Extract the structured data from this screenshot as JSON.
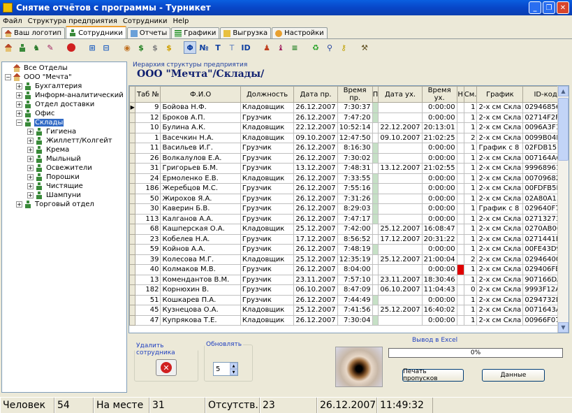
{
  "window": {
    "title": "Снятие отчётов с программы - Турникет"
  },
  "menu": [
    "Файл",
    "Структура предприятия",
    "Сотрудники",
    "Help"
  ],
  "tabs": [
    {
      "label": "Ваш логотип",
      "icon": "home-icon"
    },
    {
      "label": "Сотрудники",
      "icon": "person-icon",
      "active": true
    },
    {
      "label": "Отчеты",
      "icon": "report-icon"
    },
    {
      "label": "Графики",
      "icon": "schedule-icon"
    },
    {
      "label": "Выгрузка",
      "icon": "export-icon"
    },
    {
      "label": "Настройки",
      "icon": "settings-icon"
    }
  ],
  "tree": [
    {
      "label": "Все Отделы",
      "level": 0,
      "pm": "none"
    },
    {
      "label": "ООО \"Мечта\"",
      "level": 0,
      "pm": "−"
    },
    {
      "label": "Бухгалтерия",
      "level": 1,
      "pm": "+"
    },
    {
      "label": "Информ-аналитический",
      "level": 1,
      "pm": "+"
    },
    {
      "label": "Отдел доставки",
      "level": 1,
      "pm": "+"
    },
    {
      "label": "Офис",
      "level": 1,
      "pm": "+"
    },
    {
      "label": "Склады",
      "level": 1,
      "pm": "−",
      "selected": true
    },
    {
      "label": "Гигиена",
      "level": 2,
      "pm": "+"
    },
    {
      "label": "Жиллетт/Колгейт",
      "level": 2,
      "pm": "+"
    },
    {
      "label": "Крема",
      "level": 2,
      "pm": "+"
    },
    {
      "label": "Мыльный",
      "level": 2,
      "pm": "+"
    },
    {
      "label": "Освежители",
      "level": 2,
      "pm": "+"
    },
    {
      "label": "Порошки",
      "level": 2,
      "pm": "+"
    },
    {
      "label": "Чистящие",
      "level": 2,
      "pm": "+"
    },
    {
      "label": "Шампуни",
      "level": 2,
      "pm": "+"
    },
    {
      "label": "Торговый отдел",
      "level": 1,
      "pm": "+"
    }
  ],
  "hierarchy_caption": "Иерархия структуры предприятия",
  "breadcrumb": "ООО \"Мечта\"/Склады/",
  "columns": [
    "Таб №",
    "Ф.И.О",
    "Должность",
    "Дата пр.",
    "Время пр.",
    "П",
    "Дата ух.",
    "Время ух.",
    "Н",
    "См.",
    "График",
    "ID-код"
  ],
  "rows": [
    [
      "9",
      "Бойова Н.Ф.",
      "Кладовщик",
      "26.12.2007",
      "7:30:37",
      "g",
      "",
      "0:00:00",
      "",
      "1",
      "2-х см Скла",
      "02946856"
    ],
    [
      "12",
      "Броков А.П.",
      "Грузчик",
      "26.12.2007",
      "7:47:20",
      "g",
      "",
      "0:00:00",
      "",
      "1",
      "2-х см Скла",
      "02714F2F"
    ],
    [
      "10",
      "Булина А.К.",
      "Кладовщик",
      "22.12.2007",
      "10:52:14",
      "",
      "22.12.2007",
      "20:13:01",
      "",
      "1",
      "2-х см Скла",
      "0096A3F1"
    ],
    [
      "1",
      "Васечкин Н.А.",
      "Кладовщик",
      "09.10.2007",
      "12:47:50",
      "",
      "09.10.2007",
      "21:02:25",
      "",
      "2",
      "2-х см Скла",
      "0099B04D"
    ],
    [
      "11",
      "Васильев И.Г.",
      "Грузчик",
      "26.12.2007",
      "8:16:30",
      "g",
      "",
      "0:00:00",
      "",
      "1",
      "График с 8",
      "02FDB15B"
    ],
    [
      "26",
      "Волкалулов Е.А.",
      "Грузчик",
      "26.12.2007",
      "7:30:02",
      "g",
      "",
      "0:00:00",
      "",
      "1",
      "2-х см Скла",
      "007164A6"
    ],
    [
      "31",
      "Григорьев Б.М.",
      "Грузчик",
      "13.12.2007",
      "7:48:31",
      "",
      "13.12.2007",
      "21:02:55",
      "",
      "1",
      "2-х см Скла",
      "99968961"
    ],
    [
      "24",
      "Ермоленко Е.В.",
      "Кладовщик",
      "26.12.2007",
      "7:33:55",
      "g",
      "",
      "0:00:00",
      "",
      "1",
      "2-х см Скла",
      "00709682"
    ],
    [
      "186",
      "Жеребцов М.С.",
      "Грузчик",
      "26.12.2007",
      "7:55:16",
      "g",
      "",
      "0:00:00",
      "",
      "1",
      "2-х см Скла",
      "00FDFB5E"
    ],
    [
      "50",
      "Жирохов Я.А.",
      "Грузчик",
      "26.12.2007",
      "7:31:26",
      "g",
      "",
      "0:00:00",
      "",
      "1",
      "2-х см Скла",
      "02A80A13"
    ],
    [
      "30",
      "Каверин Б.В.",
      "Грузчик",
      "26.12.2007",
      "8:29:03",
      "g",
      "",
      "0:00:00",
      "",
      "1",
      "График с 8",
      "029640F7"
    ],
    [
      "113",
      "Калганов А.А.",
      "Грузчик",
      "26.12.2007",
      "7:47:17",
      "g",
      "",
      "0:00:00",
      "",
      "1",
      "2-х см Скла",
      "02713273"
    ],
    [
      "68",
      "Кашперская О.А.",
      "Кладовщик",
      "25.12.2007",
      "7:42:00",
      "",
      "25.12.2007",
      "16:08:47",
      "",
      "1",
      "2-х см Скла",
      "0270AB00"
    ],
    [
      "23",
      "Кобелев Н.А.",
      "Грузчик",
      "17.12.2007",
      "8:56:52",
      "",
      "17.12.2007",
      "20:31:22",
      "",
      "1",
      "2-х см Скла",
      "0271441B"
    ],
    [
      "59",
      "Койнов А.А.",
      "Грузчик",
      "26.12.2007",
      "7:48:19",
      "g",
      "",
      "0:00:00",
      "",
      "1",
      "2-х см Скла",
      "00FE43D9"
    ],
    [
      "39",
      "Колесова М.Г.",
      "Кладовщик",
      "25.12.2007",
      "12:35:19",
      "",
      "25.12.2007",
      "21:00:04",
      "",
      "2",
      "2-х см Скла",
      "02946400"
    ],
    [
      "40",
      "Колмаков М.В.",
      "Грузчик",
      "26.12.2007",
      "8:04:00",
      "",
      "",
      "0:00:00",
      "r",
      "1",
      "2-х см Скла",
      "029406FB"
    ],
    [
      "13",
      "Комендантов В.М.",
      "Грузчик",
      "23.11.2007",
      "7:57:10",
      "",
      "23.11.2007",
      "18:30:46",
      "",
      "1",
      "2-х см Скла",
      "907166DA"
    ],
    [
      "182",
      "Корнюхин В.",
      "Грузчик",
      "06.10.2007",
      "8:47:09",
      "",
      "06.10.2007",
      "11:04:43",
      "",
      "0",
      "2-х см Скла",
      "9993F12A"
    ],
    [
      "51",
      "Кошкарев П.А.",
      "Грузчик",
      "26.12.2007",
      "7:44:49",
      "g",
      "",
      "0:00:00",
      "",
      "1",
      "2-х см Скла",
      "0294732D"
    ],
    [
      "45",
      "Кузнецова О.А.",
      "Кладовщик",
      "25.12.2007",
      "7:41:56",
      "",
      "25.12.2007",
      "16:40:02",
      "",
      "1",
      "2-х см Скла",
      "0071643A"
    ],
    [
      "47",
      "Купрякова Т.Е.",
      "Кладовщик",
      "26.12.2007",
      "7:30:04",
      "g",
      "",
      "0:00:00",
      "",
      "1",
      "2-х см Скла",
      "00966F07"
    ]
  ],
  "delete_group": {
    "legend": "Удалить сотрудника"
  },
  "refresh_group": {
    "legend": "Обновлять",
    "value": "5"
  },
  "export": {
    "legend": "Вывод в Excel",
    "progress_text": "0%",
    "progress": 0,
    "print_label": "Печать пропусков",
    "data_label": "Данные"
  },
  "status": {
    "people_label": "Человек",
    "people": "54",
    "present_label": "На месте",
    "present": "31",
    "absent_label": "Отсутств.",
    "absent": "23",
    "date": "26.12.2007",
    "time": "11:49:32"
  }
}
